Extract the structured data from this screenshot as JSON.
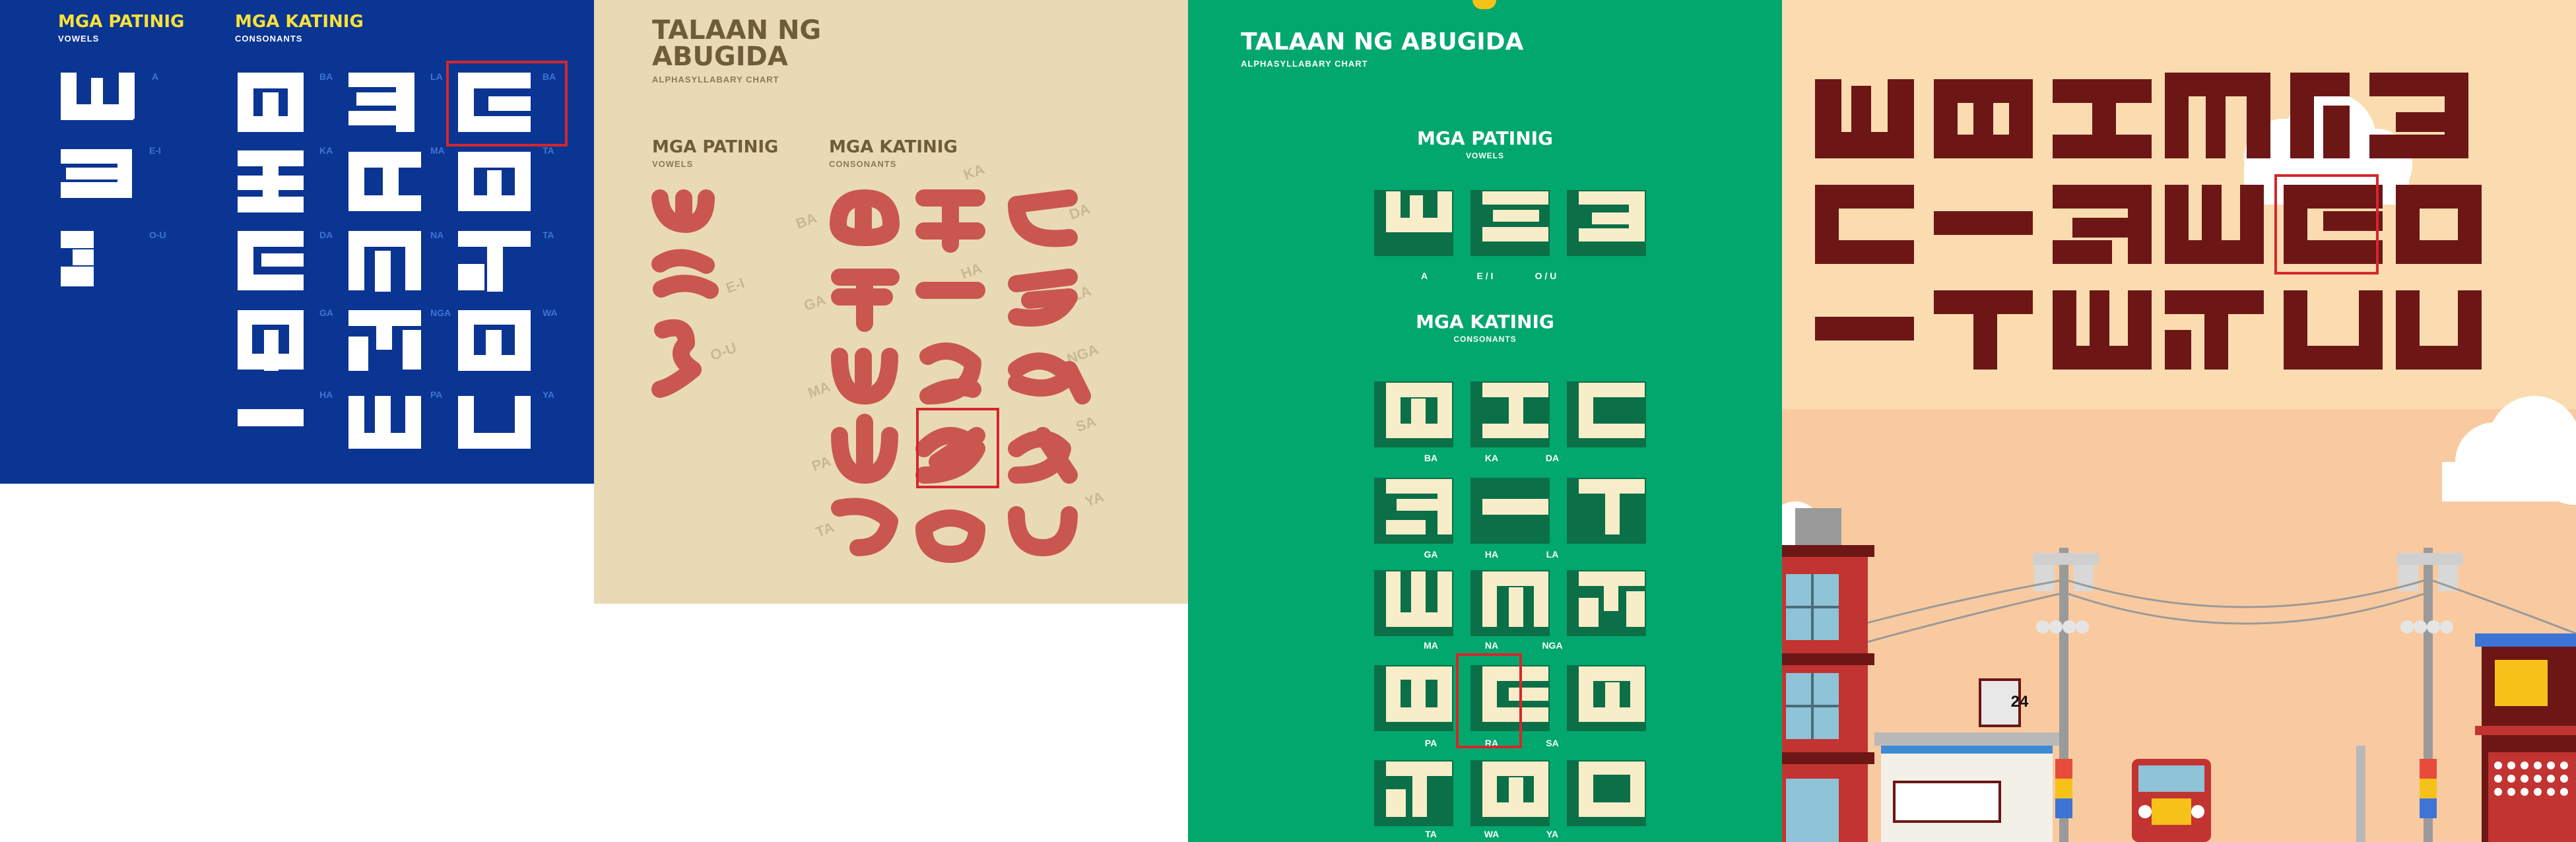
{
  "panel_blue": {
    "vowels_title": "MGA PATINIG",
    "vowels_sub": "VOWELS",
    "consonants_title": "MGA KATINIG",
    "consonants_sub": "CONSONANTS",
    "vowel_labels": [
      "A",
      "E-I",
      "O-U"
    ],
    "left_labels": [
      "BA",
      "KA",
      "DA",
      "GA",
      "HA"
    ],
    "mid_labels": [
      "LA",
      "MA",
      "NA",
      "NGA",
      "PA"
    ],
    "right_labels": [
      "BA",
      "TA",
      "TA",
      "WA",
      "YA"
    ],
    "colors": {
      "background": "#0b3592",
      "heading": "#f7e13a",
      "glyph": "#ffffff",
      "label": "#3d74d6"
    }
  },
  "panel_beige": {
    "title_line1": "TALAAN NG",
    "title_line2": "ABUGIDA",
    "subtitle": "ALPHASYLLABARY CHART",
    "vowels_title": "MGA PATINIG",
    "vowels_sub": "VOWELS",
    "consonants_title": "MGA KATINIG",
    "consonants_sub": "CONSONANTS",
    "vowel_labels": [
      "E-I",
      "O-U"
    ],
    "consonant_labels": [
      "KA",
      "BA",
      "DA",
      "GA",
      "HA",
      "LA",
      "MA",
      "NGA",
      "PA",
      "SA",
      "TA",
      "YA"
    ],
    "colors": {
      "background": "#e9dab6",
      "heading": "#6f5c3a",
      "glyph": "#c9574f",
      "label": "#c9b892"
    }
  },
  "panel_green": {
    "title": "TALAAN NG ABUGIDA",
    "subtitle": "ALPHASYLLABARY CHART",
    "vowels_title": "MGA PATINIG",
    "vowels_sub": "VOWELS",
    "vowel_labels": [
      "A",
      "E / I",
      "O / U"
    ],
    "consonants_title": "MGA KATINIG",
    "consonants_sub": "CONSONANTS",
    "row_labels": [
      [
        "BA",
        "KA",
        "DA"
      ],
      [
        "GA",
        "HA",
        "LA"
      ],
      [
        "MA",
        "NA",
        "NGA"
      ],
      [
        "PA",
        "RA",
        "SA"
      ],
      [
        "TA",
        "WA",
        "YA"
      ]
    ],
    "colors": {
      "background": "#01a76d",
      "glyph": "#f7edc8",
      "glyph_shadow": "#0b6f48",
      "text": "#ffffff"
    }
  },
  "panel_poster": {
    "sign_number": "24",
    "colors": {
      "sky": "#fbdcb0",
      "glyph": "#6d1616",
      "building": "#d03a36"
    }
  },
  "highlight_color": "#d6262c"
}
